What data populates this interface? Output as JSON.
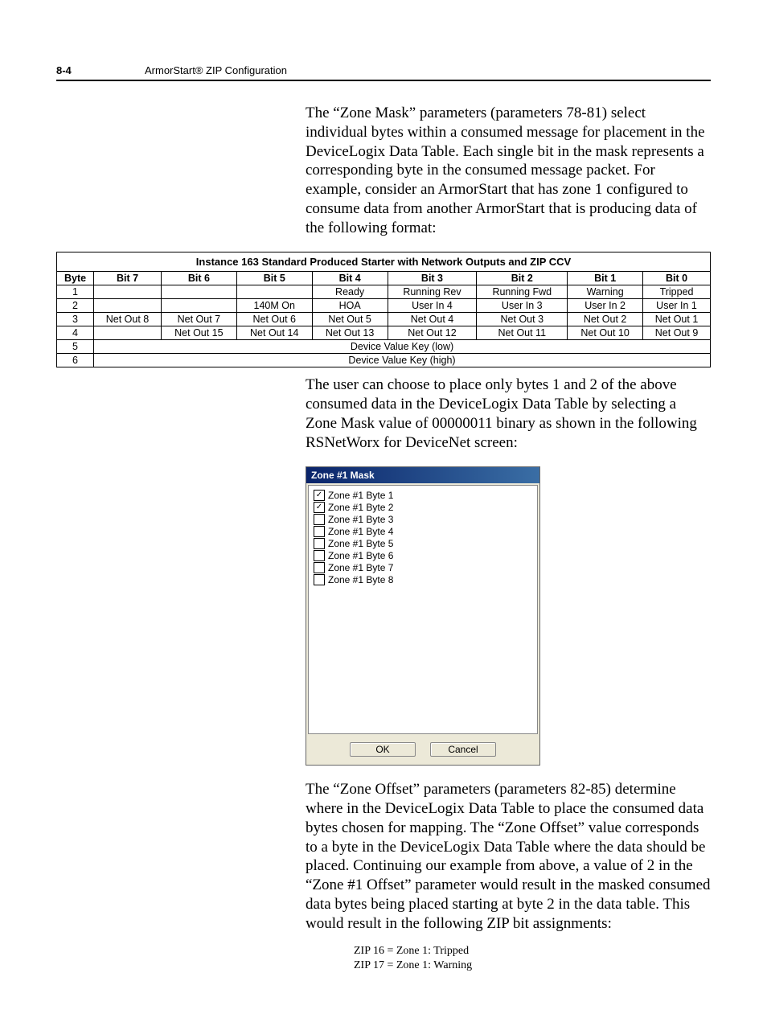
{
  "header": {
    "page_num": "8-4",
    "section": "ArmorStart® ZIP Configuration"
  },
  "paragraphs": {
    "p1": "The “Zone Mask” parameters (parameters 78-81) select individual bytes within a consumed message for placement in the DeviceLogix Data Table. Each single bit in the mask represents a corresponding byte in the consumed message packet. For example, consider an ArmorStart that has zone 1 configured to consume data from another ArmorStart that is producing data of the following format:",
    "p2": "The user can choose to place only bytes 1 and 2 of the above consumed data in the DeviceLogix Data Table by selecting a Zone Mask value of 00000011 binary as shown in the following RSNetWorx for DeviceNet screen:",
    "p3": "The “Zone Offset” parameters (parameters 82-85) determine where in the DeviceLogix Data Table to place the consumed data bytes chosen for mapping. The “Zone Offset” value corresponds to a byte in the DeviceLogix Data Table where the data should be placed. Continuing our example from above, a value of 2 in the “Zone #1 Offset” parameter would result in the masked consumed data bytes being placed starting at byte 2 in the data table. This would result in the following ZIP bit assignments:"
  },
  "table": {
    "title": "Instance 163 Standard Produced Starter with Network Outputs and ZIP CCV",
    "headers": [
      "Byte",
      "Bit 7",
      "Bit 6",
      "Bit 5",
      "Bit 4",
      "Bit 3",
      "Bit 2",
      "Bit 1",
      "Bit 0"
    ],
    "rows": [
      {
        "byte": "1",
        "cells": [
          "",
          "",
          "",
          "Ready",
          "Running Rev",
          "Running Fwd",
          "Warning",
          "Tripped"
        ]
      },
      {
        "byte": "2",
        "cells": [
          "",
          "",
          "140M On",
          "HOA",
          "User In 4",
          "User In 3",
          "User In 2",
          "User In 1"
        ]
      },
      {
        "byte": "3",
        "cells": [
          "Net Out 8",
          "Net Out 7",
          "Net Out 6",
          "Net Out 5",
          "Net Out 4",
          "Net Out 3",
          "Net Out 2",
          "Net Out 1"
        ]
      },
      {
        "byte": "4",
        "cells": [
          "",
          "Net Out 15",
          "Net Out 14",
          "Net Out 13",
          "Net Out 12",
          "Net Out 11",
          "Net Out 10",
          "Net Out 9"
        ]
      }
    ],
    "span_rows": [
      {
        "byte": "5",
        "label": "Device Value Key (low)"
      },
      {
        "byte": "6",
        "label": "Device Value Key (high)"
      }
    ]
  },
  "dialog": {
    "title": "Zone #1 Mask",
    "items": [
      {
        "label": "Zone #1 Byte 1",
        "checked": true
      },
      {
        "label": "Zone #1 Byte 2",
        "checked": true
      },
      {
        "label": "Zone #1 Byte 3",
        "checked": false
      },
      {
        "label": "Zone #1 Byte 4",
        "checked": false
      },
      {
        "label": "Zone #1 Byte 5",
        "checked": false
      },
      {
        "label": "Zone #1 Byte 6",
        "checked": false
      },
      {
        "label": "Zone #1 Byte 7",
        "checked": false
      },
      {
        "label": "Zone #1 Byte 8",
        "checked": false
      }
    ],
    "ok": "OK",
    "cancel": "Cancel"
  },
  "zip": {
    "a": "ZIP 16 = Zone 1: Tripped",
    "b": "ZIP 17 = Zone 1: Warning"
  }
}
